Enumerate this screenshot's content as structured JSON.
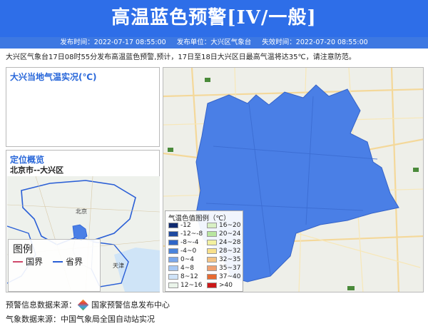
{
  "header": {
    "title": "高温蓝色预警[IV/一般]",
    "publish_time": "发布时间：2022-07-17 08:55:00",
    "publisher": "发布单位：大兴区气象台",
    "expire_time": "失效时间：2022-07-20 08:55:00"
  },
  "description": "大兴区气象台17日08时55分发布高温蓝色预警,预计，17日至18日大兴区日最高气温将达35℃，请注意防范。",
  "temp_panel": {
    "title": "大兴当地气温实况(℃)"
  },
  "location_panel": {
    "title": "定位概览",
    "subtitle": "北京市--大兴区",
    "map_labels": {
      "beijing": "北京",
      "tianjin": "天津"
    },
    "legend": {
      "title": "图例",
      "country": "国界",
      "province": "省界"
    }
  },
  "temp_scale": {
    "title": "气温色值图例（℃）",
    "items": [
      {
        "label": "-12",
        "color": "#102a70"
      },
      {
        "label": "-12~-8",
        "color": "#1f4aa0"
      },
      {
        "label": "-8~-4",
        "color": "#2f66c8"
      },
      {
        "label": "-4~0",
        "color": "#4a84dc"
      },
      {
        "label": "0~4",
        "color": "#7aa8ec"
      },
      {
        "label": "4~8",
        "color": "#a6c8f4"
      },
      {
        "label": "8~12",
        "color": "#cfe3f8"
      },
      {
        "label": "12~16",
        "color": "#eaf4ea"
      },
      {
        "label": "16~20",
        "color": "#d8f0c4"
      },
      {
        "label": "20~24",
        "color": "#b8e6a0"
      },
      {
        "label": "24~28",
        "color": "#f2f0a0"
      },
      {
        "label": "28~32",
        "color": "#f8e08a"
      },
      {
        "label": "32~35",
        "color": "#f4c484"
      },
      {
        "label": "35~37",
        "color": "#f0a070"
      },
      {
        "label": "37~40",
        "color": "#e86a30"
      },
      {
        "label": ">40",
        "color": "#cc1818"
      }
    ]
  },
  "sources": {
    "warning_label": "预警信息数据来源：",
    "warning_source": "国家预警信息发布中心",
    "weather_label": "气象数据来源：",
    "weather_source": "中国气象局全国自动站实况"
  },
  "colors": {
    "header": "#2e6ee8",
    "meta_bar": "#3d78e2",
    "region_fill": "#4a7fe6",
    "title_blue": "#2766d9"
  }
}
